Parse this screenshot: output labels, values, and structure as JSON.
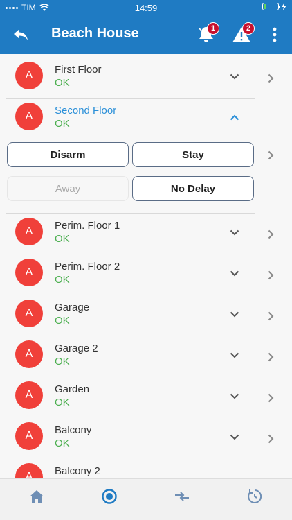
{
  "status_bar": {
    "carrier": "TIM",
    "time": "14:59"
  },
  "app_bar": {
    "title": "Beach House",
    "notifications_count": "1",
    "alerts_count": "2"
  },
  "zones": [
    {
      "avatar": "A",
      "name": "First Floor",
      "status": "OK"
    },
    {
      "avatar": "A",
      "name": "Second Floor",
      "status": "OK"
    },
    {
      "avatar": "A",
      "name": "Perim. Floor 1",
      "status": "OK"
    },
    {
      "avatar": "A",
      "name": "Perim. Floor 2",
      "status": "OK"
    },
    {
      "avatar": "A",
      "name": "Garage",
      "status": "OK"
    },
    {
      "avatar": "A",
      "name": "Garage 2",
      "status": "OK"
    },
    {
      "avatar": "A",
      "name": "Garden",
      "status": "OK"
    },
    {
      "avatar": "A",
      "name": "Balcony",
      "status": "OK"
    },
    {
      "avatar": "A",
      "name": "Balcony 2",
      "status": ""
    }
  ],
  "arm_actions": {
    "disarm": "Disarm",
    "stay": "Stay",
    "away": "Away",
    "no_delay": "No Delay"
  },
  "colors": {
    "brand": "#1f7bc3",
    "ok": "#4caf50",
    "avatar": "#f0403a",
    "badge": "#c8102e",
    "expanded_name": "#2a8fd8"
  },
  "icons": {
    "back": "arrow-back-icon",
    "notifications": "bell-icon",
    "alerts": "warning-icon",
    "menu": "more-vert-icon",
    "expand": "chevron-down-icon",
    "collapse": "chevron-up-icon",
    "navigate": "chevron-right-icon",
    "tabs": [
      "home-icon",
      "record-icon",
      "transfer-icon",
      "timer-icon"
    ]
  }
}
